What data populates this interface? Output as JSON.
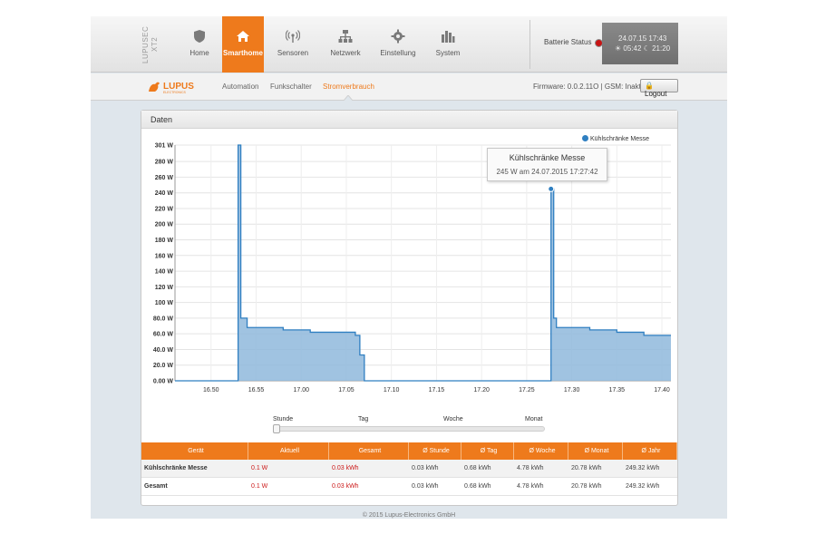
{
  "brand": {
    "vertical": "LUPUSEC XT2",
    "logo_text": "LUPUS",
    "logo_sub": "ELECTRONICS"
  },
  "nav": [
    {
      "label": "Home",
      "icon": "shield-icon",
      "active": false
    },
    {
      "label": "Smarthome",
      "icon": "house-icon",
      "active": true
    },
    {
      "label": "Sensoren",
      "icon": "antenna-icon",
      "active": false
    },
    {
      "label": "Netzwerk",
      "icon": "network-icon",
      "active": false
    },
    {
      "label": "Einstellung",
      "icon": "gear-icon",
      "active": false
    },
    {
      "label": "System",
      "icon": "bars-icon",
      "active": false
    }
  ],
  "status": {
    "battery_label": "Batterie Status",
    "battery_color": "#c81414",
    "datetime": "24.07.15 17:43",
    "sunrise": "05:42",
    "sunset": "21:20"
  },
  "subnav": {
    "tabs": [
      "Automation",
      "Funkschalter",
      "Stromverbrauch"
    ],
    "active_tab": "Stromverbrauch",
    "firmware": "Firmware: 0.0.2.11O | GSM: Inaktiv",
    "logout": "Logout"
  },
  "panel": {
    "title": "Daten"
  },
  "tooltip": {
    "title": "Kühlschränke Messe",
    "value": "245 W am 24.07.2015 17:27:42"
  },
  "range": {
    "options": [
      "Stunde",
      "Tag",
      "Woche",
      "Monat"
    ],
    "selected": "Stunde"
  },
  "table": {
    "headers": [
      "Gerät",
      "Aktuell",
      "Gesamt",
      "Ø Stunde",
      "Ø Tag",
      "Ø Woche",
      "Ø Monat",
      "Ø Jahr"
    ],
    "rows": [
      [
        "Kühlschränke Messe",
        "0.1 W",
        "0.03 kWh",
        "0.03 kWh",
        "0.68 kWh",
        "4.78 kWh",
        "20.78 kWh",
        "249.32 kWh"
      ],
      [
        "Gesamt",
        "0.1 W",
        "0.03 kWh",
        "0.03 kWh",
        "0.68 kWh",
        "4.78 kWh",
        "20.78 kWh",
        "249.32 kWh"
      ]
    ]
  },
  "footer": "© 2015 Lupus-Electronics GmbH",
  "colors": {
    "accent": "#ee7a1c",
    "series_fill": "#8fb8dc",
    "series_line": "#2f7fc1"
  },
  "chart_data": {
    "type": "area",
    "series": [
      {
        "name": "Kühlschränke Messe",
        "points": [
          [
            "16.46",
            0
          ],
          [
            "16.53",
            0
          ],
          [
            "16.53",
            301
          ],
          [
            "16.533",
            80
          ],
          [
            "16.54",
            68
          ],
          [
            "16.58",
            65
          ],
          [
            "17.01",
            62
          ],
          [
            "17.06",
            58
          ],
          [
            "17.065",
            33
          ],
          [
            "17.07",
            0
          ],
          [
            "17.277",
            0
          ],
          [
            "17.277",
            245
          ],
          [
            "17.28",
            80
          ],
          [
            "17.283",
            68
          ],
          [
            "17.32",
            65
          ],
          [
            "17.35",
            62
          ],
          [
            "17.38",
            58
          ],
          [
            "17.41",
            58
          ]
        ]
      }
    ],
    "xticks": [
      "16.50",
      "16.55",
      "17.00",
      "17.05",
      "17.10",
      "17.15",
      "17.20",
      "17.25",
      "17.30",
      "17.35",
      "17.40"
    ],
    "yticks": [
      "0.00 W",
      "20.0 W",
      "40.0 W",
      "60.0 W",
      "80.0 W",
      "100 W",
      "120 W",
      "140 W",
      "160 W",
      "180 W",
      "200 W",
      "220 W",
      "240 W",
      "260 W",
      "280 W",
      "301 W"
    ],
    "ylim": [
      0,
      301
    ],
    "grid": true,
    "legend": "top-right",
    "highlight_point": [
      "17.277",
      245
    ]
  }
}
